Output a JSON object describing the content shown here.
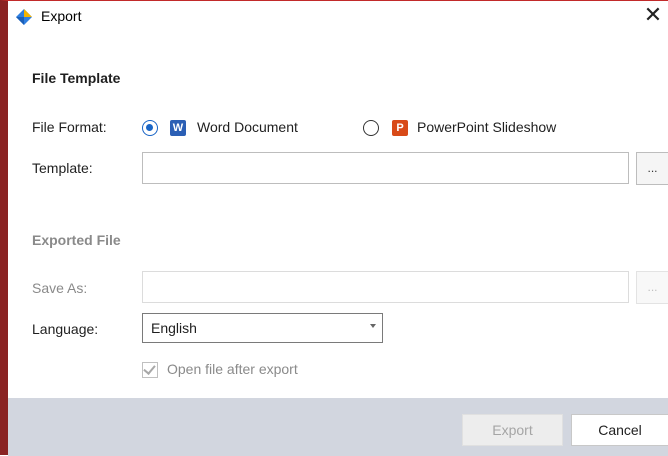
{
  "window": {
    "title": "Export",
    "close_glyph": "✕",
    "icon": "diamond-app-icon",
    "accent_color": "#1a65c6"
  },
  "file_template": {
    "heading": "File Template",
    "format_label": "File Format:",
    "options": [
      {
        "label": "Word Document",
        "badge": "W",
        "selected": true
      },
      {
        "label": "PowerPoint Slideshow",
        "badge": "P",
        "selected": false
      }
    ],
    "template_label": "Template:",
    "template_value": "",
    "browse_label": "..."
  },
  "exported_file": {
    "heading": "Exported File",
    "save_as_label": "Save As:",
    "save_as_value": "",
    "browse_label": "...",
    "language_label": "Language:",
    "language_value": "English",
    "open_after_label": "Open file after export",
    "open_after_checked": true
  },
  "buttons": {
    "export": "Export",
    "cancel": "Cancel"
  }
}
